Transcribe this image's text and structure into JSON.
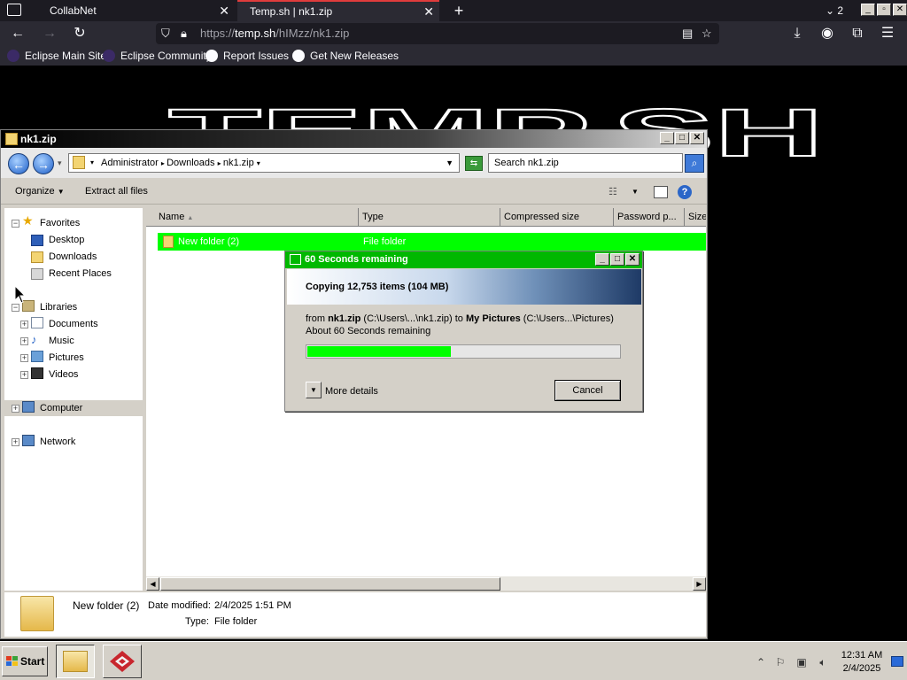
{
  "browser": {
    "tabs": [
      {
        "label": "CollabNet"
      },
      {
        "label": "Temp.sh | nk1.zip"
      }
    ],
    "tab_count": "2",
    "url_prefix": "https://",
    "url_host": "temp.sh",
    "url_path": "/hIMzz/nk1.zip",
    "bookmarks": [
      "Eclipse Main Site",
      "Eclipse Community",
      "Report Issues",
      "Get New Releases"
    ]
  },
  "page": {
    "logo_text": "TEMP.SH"
  },
  "explorer": {
    "title": "nk1.zip",
    "breadcrumb": [
      "Administrator",
      "Downloads",
      "nk1.zip"
    ],
    "search_placeholder": "Search nk1.zip",
    "commands": {
      "organize": "Organize",
      "extract": "Extract all files"
    },
    "nav": {
      "favorites": "Favorites",
      "desktop": "Desktop",
      "downloads": "Downloads",
      "recent": "Recent Places",
      "libraries": "Libraries",
      "documents": "Documents",
      "music": "Music",
      "pictures": "Pictures",
      "videos": "Videos",
      "computer": "Computer",
      "network": "Network"
    },
    "columns": [
      "Name",
      "Type",
      "Compressed size",
      "Password p...",
      "Size"
    ],
    "rows": [
      {
        "name": "New folder (2)",
        "type": "File folder"
      }
    ],
    "details": {
      "name": "New folder (2)",
      "modified_label": "Date modified:",
      "modified_value": "2/4/2025 1:51 PM",
      "type_label": "Type:",
      "type_value": "File folder"
    }
  },
  "copy_dialog": {
    "title": "60 Seconds remaining",
    "heading": "Copying 12,753 items (104 MB)",
    "from_label": "from",
    "from_name": "nk1.zip",
    "from_path": "(C:\\Users\\...\\nk1.zip)",
    "to_label": "to",
    "to_name": "My Pictures",
    "to_path": "(C:\\Users...\\Pictures)",
    "remaining": "About 60 Seconds remaining",
    "progress": 0.46,
    "more_details": "More details",
    "cancel": "Cancel"
  },
  "taskbar": {
    "start": "Start",
    "time": "12:31 AM",
    "date": "2/4/2025"
  },
  "colors": {
    "highlight": "#00ff00",
    "dialog_title": "#00b800"
  }
}
